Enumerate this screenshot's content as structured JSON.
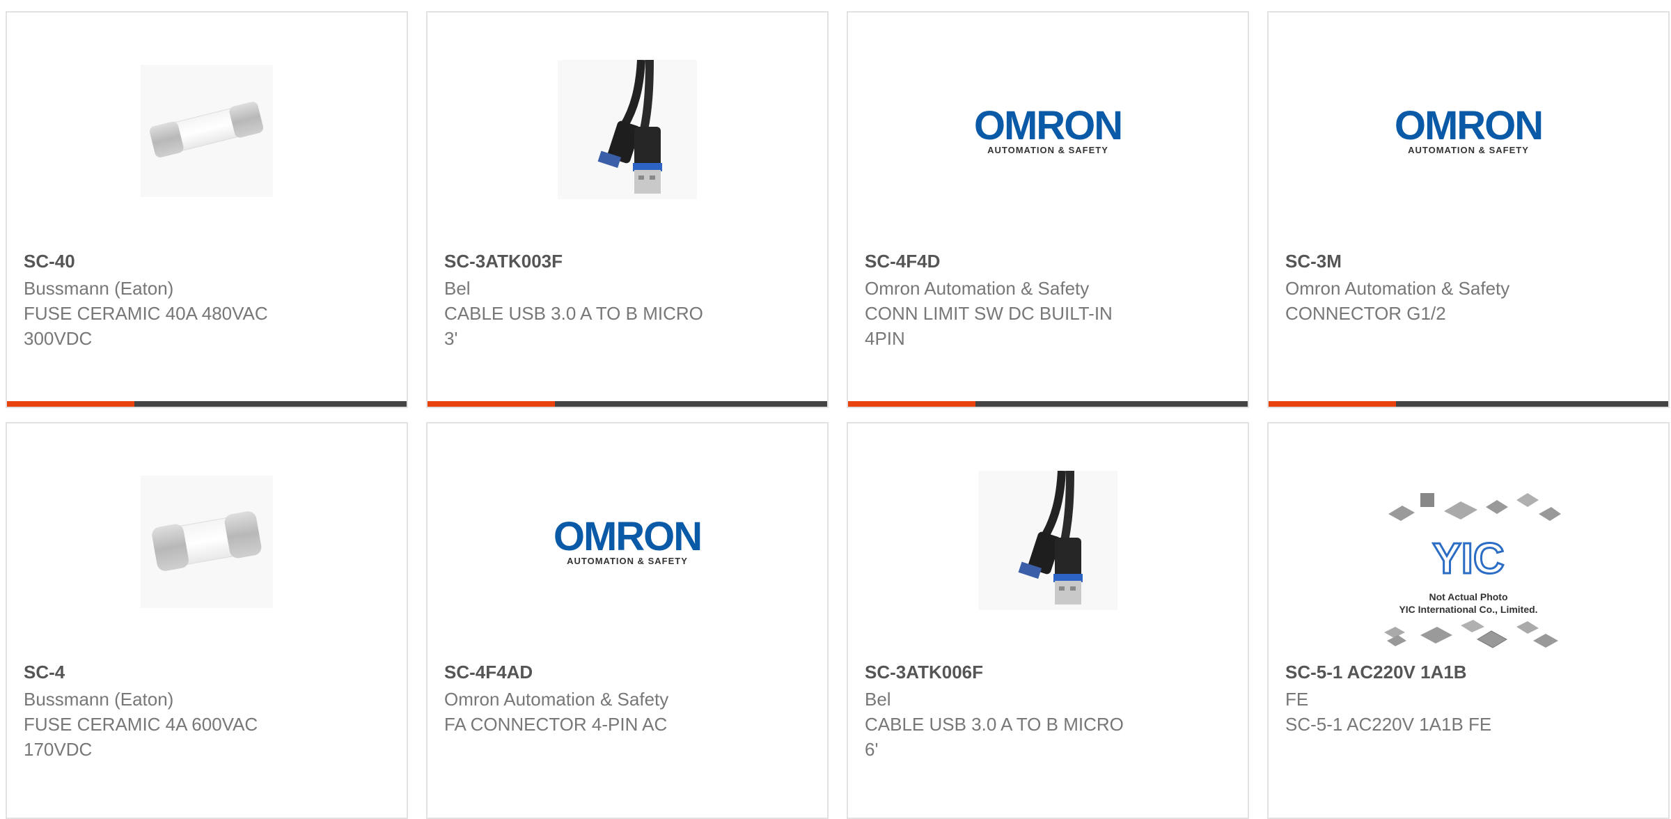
{
  "products": [
    {
      "part_number": "SC-40",
      "manufacturer": "Bussmann (Eaton)",
      "description_line1": "FUSE CERAMIC 40A 480VAC",
      "description_line2": "300VDC",
      "image": "fuse-icon"
    },
    {
      "part_number": "SC-3ATK003F",
      "manufacturer": "Bel",
      "description_line1": "CABLE USB 3.0 A TO B MICRO",
      "description_line2": "3'",
      "image": "usb-cable-icon"
    },
    {
      "part_number": "SC-4F4D",
      "manufacturer": "Omron Automation & Safety",
      "description_line1": "CONN LIMIT SW DC BUILT-IN",
      "description_line2": "4PIN",
      "image": "omron-logo"
    },
    {
      "part_number": "SC-3M",
      "manufacturer": "Omron Automation & Safety",
      "description_line1": "CONNECTOR G1/2",
      "description_line2": "",
      "image": "omron-logo"
    },
    {
      "part_number": "SC-4",
      "manufacturer": "Bussmann (Eaton)",
      "description_line1": "FUSE CERAMIC 4A 600VAC",
      "description_line2": "170VDC",
      "image": "fuse-icon"
    },
    {
      "part_number": "SC-4F4AD",
      "manufacturer": "Omron Automation & Safety",
      "description_line1": "FA CONNECTOR 4-PIN AC",
      "description_line2": "",
      "image": "omron-logo"
    },
    {
      "part_number": "SC-3ATK006F",
      "manufacturer": "Bel",
      "description_line1": "CABLE USB 3.0 A TO B MICRO",
      "description_line2": "6'",
      "image": "usb-cable-icon"
    },
    {
      "part_number": "SC-5-1 AC220V 1A1B",
      "manufacturer": "FE",
      "description_line1": "SC-5-1 AC220V 1A1B FE",
      "description_line2": "",
      "image": "yic-placeholder"
    }
  ],
  "logos": {
    "omron_name": "OMRON",
    "omron_tagline": "AUTOMATION & SAFETY",
    "yic_mark": "YIC",
    "yic_line1": "Not Actual Photo",
    "yic_line2": "YIC International Co., Limited."
  },
  "colors": {
    "accent": "#e8420f",
    "bar": "#444444",
    "part_number": "#555555",
    "text": "#777777",
    "omron_blue": "#0a5aa8"
  }
}
